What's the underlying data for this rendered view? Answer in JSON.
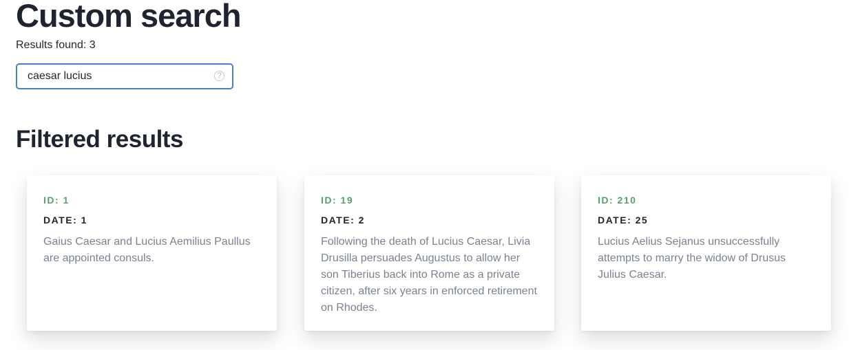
{
  "header": {
    "title": "Custom search",
    "results_found": "Results found: 3"
  },
  "search": {
    "value": "caesar lucius",
    "help_glyph": "?"
  },
  "filtered": {
    "title": "Filtered results",
    "cards": [
      {
        "id_label": "ID: 1",
        "date_label": "DATE: 1",
        "text": "Gaius Caesar and Lucius Aemilius Paullus are appointed consuls."
      },
      {
        "id_label": "ID: 19",
        "date_label": "DATE: 2",
        "text": "Following the death of Lucius Caesar, Livia Drusilla persuades Augustus to allow her son Tiberius back into Rome as a private citizen, after six years in enforced retirement on Rhodes."
      },
      {
        "id_label": "ID: 210",
        "date_label": "DATE: 25",
        "text": "Lucius Aelius Sejanus unsuccessfully attempts to marry the widow of Drusus Julius Caesar."
      }
    ]
  },
  "colors": {
    "accent_id": "#5a9e6a",
    "input_border": "#4a7fc1",
    "heading": "#1f2430",
    "body_text": "#7a8291"
  },
  "icons": {
    "help": "help-icon"
  }
}
